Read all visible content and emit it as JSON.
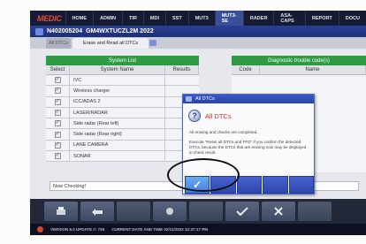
{
  "nav": {
    "logo": "MEDIC",
    "items": [
      "HOME",
      "ADMIN",
      "TIR",
      "MDI",
      "SST",
      "MUT3",
      "MUT3-SE",
      "RADER",
      "ASA-CAPS",
      "REPORT",
      "DOCU"
    ]
  },
  "vehicle": {
    "id": "N402005204",
    "vin": "GM4WXTUCZL2M 2022"
  },
  "tabs": {
    "first": "All DTCs",
    "second": "Erase and Read all DTCs"
  },
  "system_list": {
    "title": "System List",
    "columns": {
      "select": "Select",
      "name": "System Name",
      "results": "Results"
    },
    "rows": [
      {
        "checked": "✓",
        "name": "IVC"
      },
      {
        "checked": "✓",
        "name": "Wireless charger"
      },
      {
        "checked": "✓",
        "name": "ICC/ADAS 2"
      },
      {
        "checked": "✓",
        "name": "LASER/RADAR"
      },
      {
        "checked": "✓",
        "name": "Side radar (Rear left)"
      },
      {
        "checked": "✓",
        "name": "Side radar (Rear right)"
      },
      {
        "checked": "✓",
        "name": "LANE CAMERA"
      },
      {
        "checked": "✓",
        "name": "SONAR"
      }
    ]
  },
  "dtc_panel": {
    "title": "Diagnostic trouble code(s)",
    "col_code": "Code",
    "col_name": "Name"
  },
  "status_text": "Now Checking!",
  "dialog": {
    "title": "All DTCs",
    "heading": "All DTCs",
    "message1": "All erasing and checks are completed.",
    "message2": "Execute \"Reset all DTCs and FFD\" if you confirm the detected DTCs, because the DTCs that are erasing now may be displayed in check result.",
    "ok_label": "✓"
  },
  "statusbar": {
    "version": "VERSION 6.0 UPDATE #: 726",
    "datetime": "CURRENT DATE AND TIME 02/11/2022 12:37:17 PM"
  }
}
